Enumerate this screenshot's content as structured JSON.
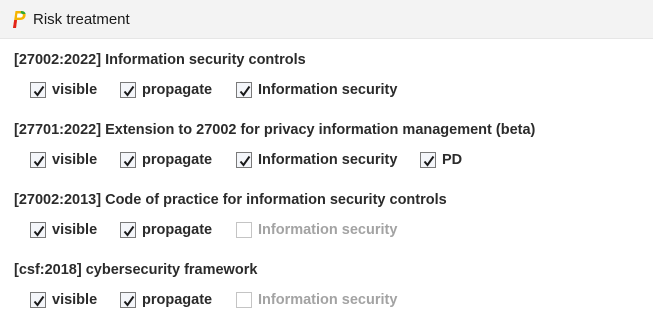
{
  "window": {
    "title": "Risk treatment",
    "icon": "app-p-icon"
  },
  "sections": [
    {
      "title": "[27002:2022] Information security controls",
      "checkboxes": [
        {
          "label": "visible",
          "checked": true,
          "enabled": true
        },
        {
          "label": "propagate",
          "checked": true,
          "enabled": true
        },
        {
          "label": "Information security",
          "checked": true,
          "enabled": true
        }
      ]
    },
    {
      "title": "[27701:2022] Extension to 27002 for privacy information management (beta)",
      "checkboxes": [
        {
          "label": "visible",
          "checked": true,
          "enabled": true
        },
        {
          "label": "propagate",
          "checked": true,
          "enabled": true
        },
        {
          "label": "Information security",
          "checked": true,
          "enabled": true
        },
        {
          "label": "PD",
          "checked": true,
          "enabled": true
        }
      ]
    },
    {
      "title": "[27002:2013] Code of practice for information security controls",
      "checkboxes": [
        {
          "label": "visible",
          "checked": true,
          "enabled": true
        },
        {
          "label": "propagate",
          "checked": true,
          "enabled": true
        },
        {
          "label": "Information security",
          "checked": false,
          "enabled": false
        }
      ]
    },
    {
      "title": "[csf:2018] cybersecurity framework",
      "checkboxes": [
        {
          "label": "visible",
          "checked": true,
          "enabled": true
        },
        {
          "label": "propagate",
          "checked": true,
          "enabled": true
        },
        {
          "label": "Information security",
          "checked": false,
          "enabled": false
        }
      ]
    }
  ],
  "colors": {
    "titlebar_bg": "#f3f3f3",
    "text": "#2b2b2b",
    "disabled_text": "#a3a3a3",
    "icon_yellow": "#f5b400",
    "icon_red": "#e2231a",
    "icon_green": "#2ea836"
  }
}
